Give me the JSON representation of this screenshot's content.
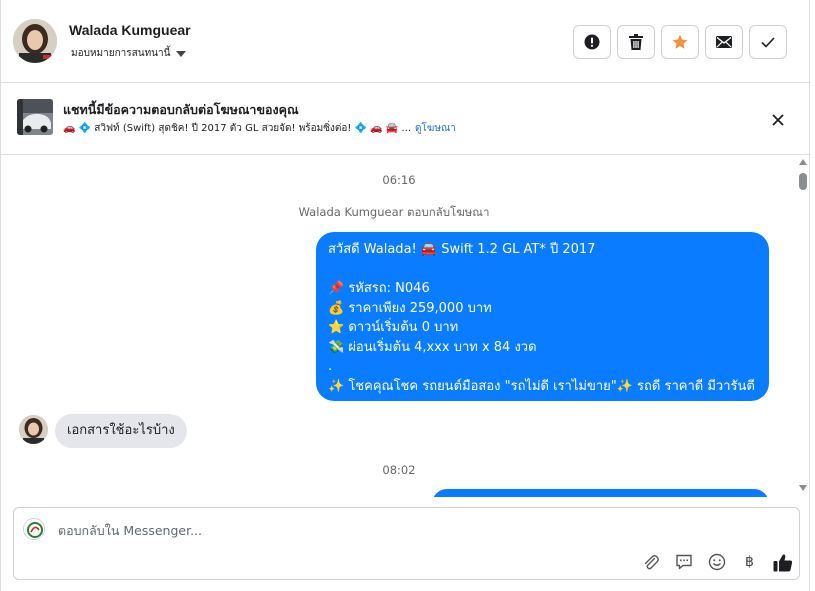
{
  "header": {
    "contact_name": "Walada Kumguear",
    "assign_label": "มอบหมายการสนทนานี้",
    "actions": [
      {
        "name": "spam-icon"
      },
      {
        "name": "trash-icon"
      },
      {
        "name": "star-icon"
      },
      {
        "name": "mail-icon"
      },
      {
        "name": "check-icon"
      }
    ],
    "accent_star": "#f7923b"
  },
  "ad_banner": {
    "title": "แชทนี้มีข้อความตอบกลับต่อโฆษณาของคุณ",
    "preview": "🚗 💠 สวิฟท์ (Swift) สุดชิค! ปี 2017 ตัว GL สวยจัด! พร้อมซิ่งต่อ! 💠 🚗 🚘 ...",
    "link": "ดูโฆษณา"
  },
  "chat": {
    "time_1": "06:16",
    "reply_note": "Walada Kumguear ตอบกลับโฆษณา",
    "outgoing_lines": [
      "สวัสดี Walada! 🚘 Swift 1.2 GL AT* ปี 2017",
      "",
      "📌 รหัสรถ: N046",
      "💰 ราคาเพียง 259,000 บาท",
      "⭐ ดาวน์เริ่มต้น 0 บาท",
      "💸 ผ่อนเริ่มต้น 4,xxx บาท x 84 งวด",
      ".",
      "✨ โชคคุณโชค รถยนต์มือสอง \"รถไม่ดี เราไม่ขาย\"✨ รถดี ราคาดี มีวารันตี"
    ],
    "incoming": "เอกสารใช้อะไรบ้าง",
    "time_2": "08:02",
    "bubble_color": "#0a7cff",
    "incoming_color": "#e4e6eb"
  },
  "composer": {
    "placeholder": "ตอบกลับใน Messenger...",
    "tools": [
      "paperclip-icon",
      "chat-bubble-icon",
      "smiley-icon",
      "baht-icon",
      "thumbs-up-icon"
    ],
    "baht_symbol": "฿"
  }
}
